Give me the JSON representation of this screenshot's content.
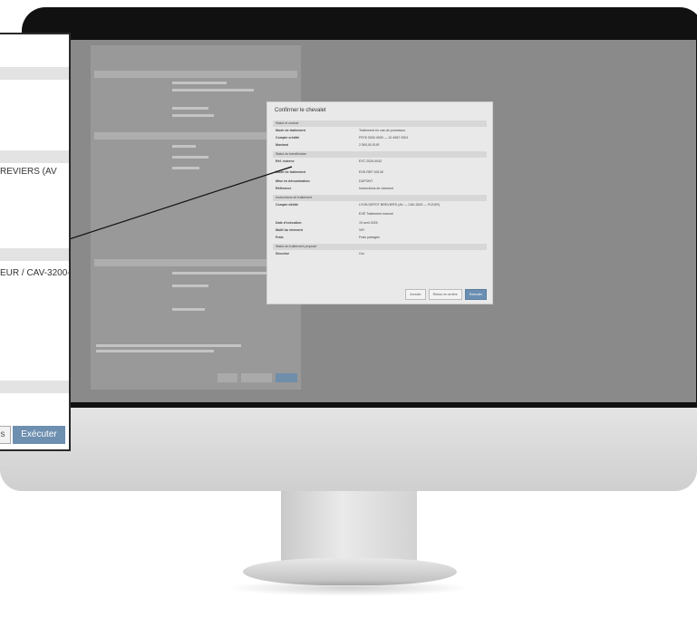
{
  "dialog": {
    "title": "Confirmer le chevalet",
    "sections": [
      "Statut et contrat",
      "Statut du bénéficiaire",
      "Instructions de traitement",
      "Statut du traitement proposé"
    ],
    "rows": [
      {
        "label": "Mode de traitement",
        "value": "Traitement en cas de processus"
      },
      {
        "label": "Compte crédité",
        "value": "FR76 3000 4000 — 10 4567 0001"
      },
      {
        "label": "Montant",
        "value": "2 500,00 EUR"
      },
      {
        "label": "Réf. externe",
        "value": "EXT-2025-0042"
      },
      {
        "label": "Mode de traitement",
        "value": "EXE-REF-00145"
      },
      {
        "label": "Mise en dénomination",
        "value": "DUPONT"
      },
      {
        "label": "Référence",
        "value": "Instructions de virement"
      },
      {
        "label": "Compte débité",
        "value": "LYON DEPOT BREVIERS (AV — CAV-3200 — FLEUR)"
      },
      {
        "label": "",
        "value": "EXÉ Traitement manuel"
      },
      {
        "label": "Date d'exécution",
        "value": "19 avril 2025"
      },
      {
        "label": "Motif du virement",
        "value": "VIR"
      },
      {
        "label": "Frais",
        "value": "Frais partagés"
      },
      {
        "label": "Sécurisé",
        "value": "Oui"
      }
    ],
    "buttons": [
      "Annuler",
      "Retour en arrière",
      "Exécuter"
    ]
  },
  "callout": {
    "text1": "REVIERS (AV",
    "text2": "EUR / CAV-3200-",
    "cancel_label": "s",
    "execute_label": "Exécuter"
  },
  "colors": {
    "primary_button": "#6d8fb0",
    "screen_background": "#8a8a8a",
    "monitor_frame": "#111111"
  }
}
